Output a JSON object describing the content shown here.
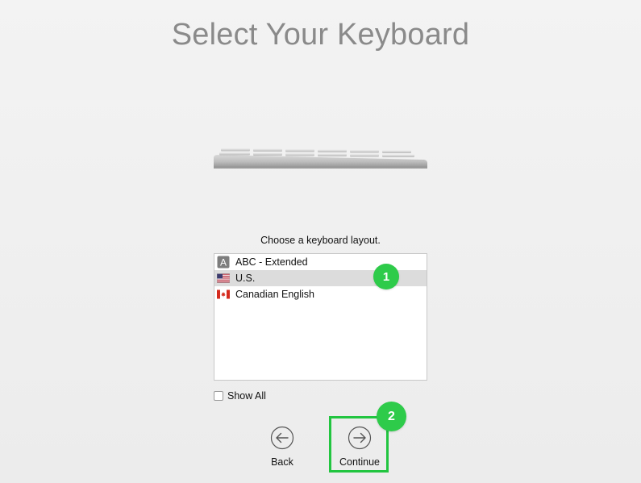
{
  "page": {
    "title": "Select Your Keyboard",
    "prompt": "Choose a keyboard layout."
  },
  "layouts": [
    {
      "label": "ABC - Extended",
      "icon": "abc-letter-icon",
      "selected": false
    },
    {
      "label": "U.S.",
      "icon": "us-flag-icon",
      "selected": true
    },
    {
      "label": "Canadian English",
      "icon": "canada-flag-icon",
      "selected": false
    }
  ],
  "show_all": {
    "label": "Show All",
    "checked": false
  },
  "navigation": {
    "back_label": "Back",
    "continue_label": "Continue"
  },
  "annotations": {
    "badge_1": "1",
    "badge_2": "2",
    "color": "#2ecb4a"
  }
}
